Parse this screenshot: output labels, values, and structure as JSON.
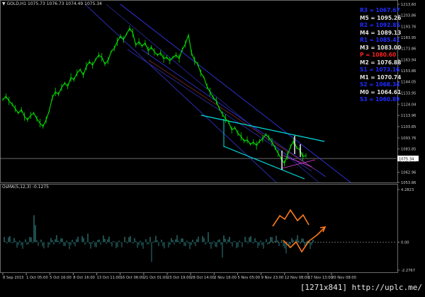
{
  "header": {
    "symbol_line": "▼ GOLD,H1  1075.73  1076.73  1074.49  1075.34"
  },
  "osma_header": "OsMA(5,12,3) -0.1275",
  "watermark": "[1271x841] http://uplc.me/",
  "pivots": [
    {
      "label": "R3 = 1067.67",
      "color": "#1e2cff"
    },
    {
      "label": "M5 = 1095.26",
      "color": "#e0e0e0"
    },
    {
      "label": "R2 = 1092.85",
      "color": "#1e2cff"
    },
    {
      "label": "M4 = 1089.13",
      "color": "#e0e0e0"
    },
    {
      "label": "R1 = 1085.41",
      "color": "#1e2cff"
    },
    {
      "label": "M3 = 1083.00",
      "color": "#e0e0e0"
    },
    {
      "label": "P  = 1080.60",
      "color": "#ff2020"
    },
    {
      "label": "M2 = 1076.88",
      "color": "#e0e0e0"
    },
    {
      "label": "S1 = 1073.16",
      "color": "#1e2cff"
    },
    {
      "label": "M1 = 1070.74",
      "color": "#e0e0e0"
    },
    {
      "label": "S2 = 1068.34",
      "color": "#1e2cff"
    },
    {
      "label": "M0 = 1064.61",
      "color": "#e0e0e0"
    },
    {
      "label": "S3 = 1060.89",
      "color": "#1e2cff"
    }
  ],
  "chart_data": [
    {
      "type": "line",
      "title": "GOLD,H1",
      "price_ticks": [
        "1213.60",
        "1203.86",
        "1193.76",
        "1183.95",
        "1173.86",
        "1163.94",
        "1153.86",
        "1144.05",
        "1133.95",
        "1124.04",
        "1113.96",
        "1103.85",
        "1093.76",
        "1083.85",
        "1075.34",
        "1073.76",
        "1062.96",
        "1053.86"
      ],
      "current_price": "1075.34",
      "ylim": [
        1053.86,
        1213.6
      ],
      "x_ticks": [
        "8 Sep 2015",
        "1 Oct 05:00",
        "5 Oct 16:00",
        "8 Oct 16:00",
        "13 Oct 11:00",
        "16 Oct 06:00",
        "21 Oct 01:00",
        "23 Oct 19:00",
        "28 Oct 14:00",
        "2 Nov 16:00",
        "5 Nov 05:00",
        "9 Nov 23:00",
        "12 Nov 08:00",
        "17 Nov 13:00",
        "20 Nov 08:00"
      ],
      "series": [
        {
          "color": "#00e000",
          "values": [
            1128,
            1131,
            1127,
            1124,
            1120,
            1116,
            1119,
            1113,
            1110,
            1114,
            1116,
            1111,
            1107,
            1104,
            1110,
            1118,
            1130,
            1135,
            1133,
            1139,
            1143,
            1140,
            1148,
            1146,
            1152,
            1155,
            1150,
            1158,
            1162,
            1159,
            1164,
            1168,
            1166,
            1160,
            1163,
            1171,
            1174,
            1180,
            1185,
            1182,
            1187,
            1192,
            1188,
            1177,
            1180,
            1176,
            1179,
            1172,
            1175,
            1171,
            1168,
            1170,
            1165,
            1166,
            1163,
            1166,
            1168,
            1165,
            1173,
            1178,
            1186,
            1170,
            1163,
            1160,
            1152,
            1148,
            1140,
            1135,
            1130,
            1127,
            1120,
            1115,
            1111,
            1108,
            1101,
            1103,
            1098,
            1095,
            1091,
            1092,
            1088,
            1090,
            1087,
            1091,
            1093,
            1097,
            1094,
            1090,
            1085,
            1080,
            1075,
            1071,
            1078,
            1086,
            1091,
            1085,
            1083,
            1077,
            1078
          ]
        }
      ]
    },
    {
      "type": "bar",
      "title": "OsMA(5,12,3) -0.1275",
      "ylim": [
        -2.2767,
        4.2823
      ],
      "ticks": [
        "4.2823",
        "0.00",
        "-2.2767"
      ]
    }
  ]
}
